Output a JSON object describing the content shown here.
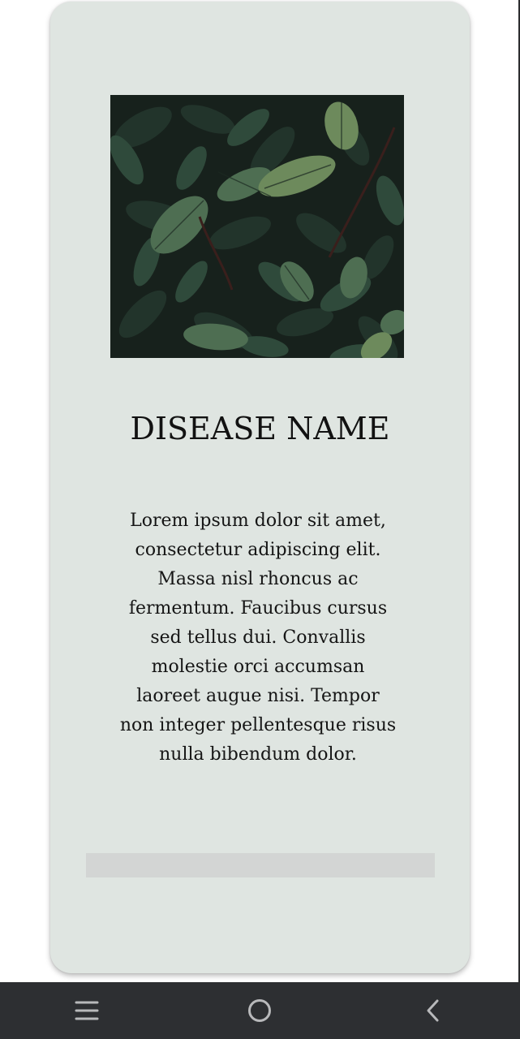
{
  "card": {
    "image": {
      "icon": "plant-leaves-photo"
    },
    "title": "DISEASE NAME",
    "description": "Lorem ipsum dolor sit amet, consectetur adipiscing elit. Massa nisl rhoncus ac fermentum. Faucibus cursus sed tellus dui. Convallis molestie orci accumsan laoreet augue nisi. Tempor non integer pellentesque risus nulla bibendum dolor.",
    "background_color": "#dfe5e1"
  },
  "navbar": {
    "background_color": "#2d2f32",
    "buttons": [
      {
        "name": "recent-apps",
        "icon": "menu-lines-icon"
      },
      {
        "name": "home",
        "icon": "home-circle-icon"
      },
      {
        "name": "back",
        "icon": "chevron-left-icon"
      }
    ],
    "icon_color": "#b8b9bb"
  }
}
